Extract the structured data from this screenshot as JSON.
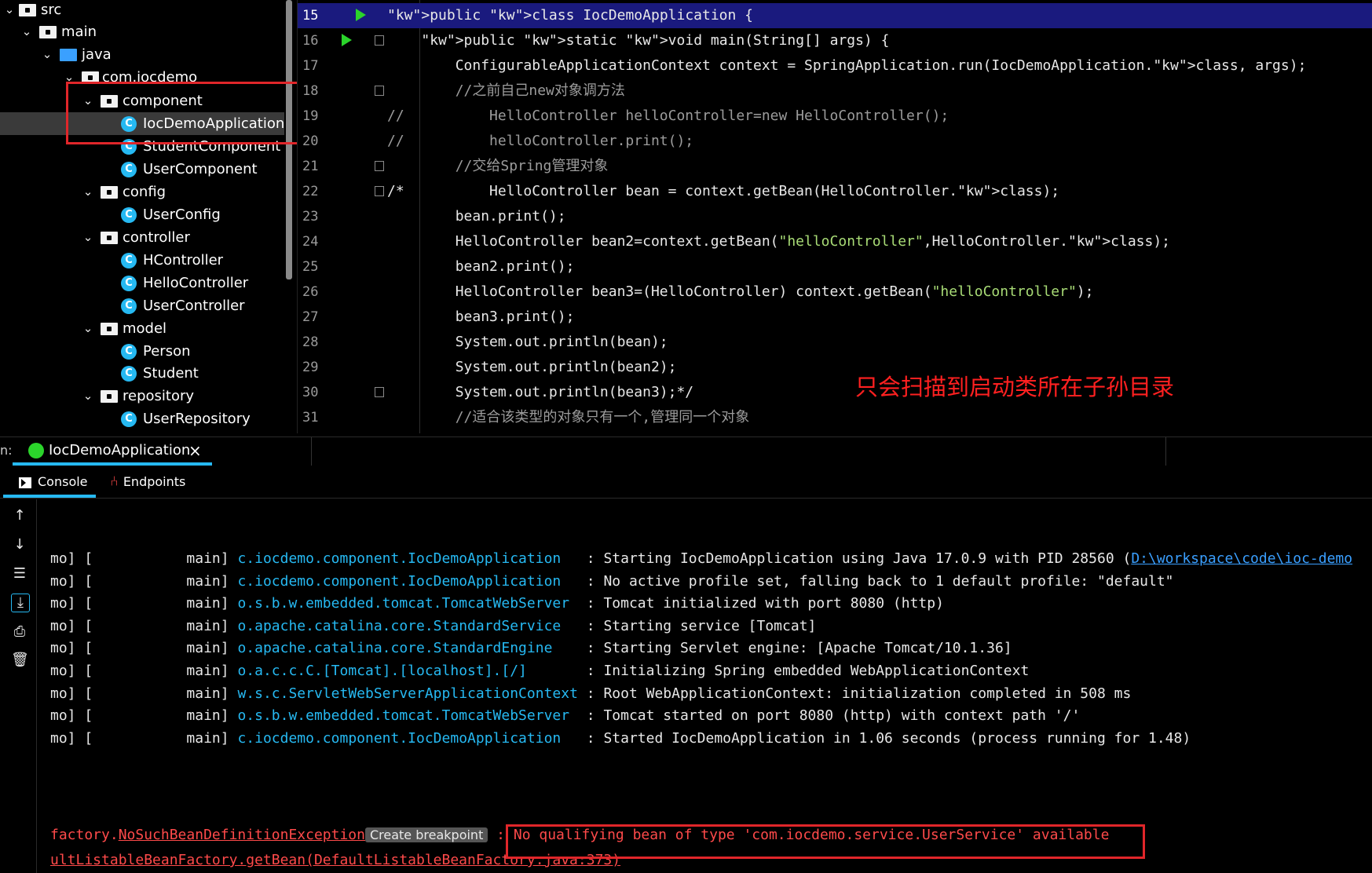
{
  "tree": {
    "items": [
      {
        "label": "src",
        "kind": "folder"
      },
      {
        "label": "main",
        "kind": "folder"
      },
      {
        "label": "java",
        "kind": "folder-blue"
      },
      {
        "label": "com.iocdemo",
        "kind": "package"
      },
      {
        "label": "component",
        "kind": "package"
      },
      {
        "label": "IocDemoApplication",
        "kind": "class-spring"
      },
      {
        "label": "StudentComponent",
        "kind": "class"
      },
      {
        "label": "UserComponent",
        "kind": "class"
      },
      {
        "label": "config",
        "kind": "package"
      },
      {
        "label": "UserConfig",
        "kind": "class"
      },
      {
        "label": "controller",
        "kind": "package"
      },
      {
        "label": "HController",
        "kind": "class"
      },
      {
        "label": "HelloController",
        "kind": "class"
      },
      {
        "label": "UserController",
        "kind": "class"
      },
      {
        "label": "model",
        "kind": "package"
      },
      {
        "label": "Person",
        "kind": "class"
      },
      {
        "label": "Student",
        "kind": "class"
      },
      {
        "label": "repository",
        "kind": "package"
      },
      {
        "label": "UserRepository",
        "kind": "class"
      }
    ]
  },
  "editor": {
    "lines": [
      {
        "num": "15",
        "text": "public class IocDemoApplication {"
      },
      {
        "num": "16",
        "text": "    public static void main(String[] args) {"
      },
      {
        "num": "17",
        "text": "        ConfigurableApplicationContext context = SpringApplication.run(IocDemoApplication.class, args);"
      },
      {
        "num": "18",
        "text": "        //之前自己new对象调方法"
      },
      {
        "num": "19",
        "text": "//          HelloController helloController=new HelloController();"
      },
      {
        "num": "20",
        "text": "//          helloController.print();"
      },
      {
        "num": "21",
        "text": "        //交给Spring管理对象"
      },
      {
        "num": "22",
        "text": "/*          HelloController bean = context.getBean(HelloController.class);"
      },
      {
        "num": "23",
        "text": "        bean.print();"
      },
      {
        "num": "24",
        "text": "        HelloController bean2=context.getBean(\"helloController\",HelloController.class);"
      },
      {
        "num": "25",
        "text": "        bean2.print();"
      },
      {
        "num": "26",
        "text": "        HelloController bean3=(HelloController) context.getBean(\"helloController\");"
      },
      {
        "num": "27",
        "text": "        bean3.print();"
      },
      {
        "num": "28",
        "text": "        System.out.println(bean);"
      },
      {
        "num": "29",
        "text": "        System.out.println(bean2);"
      },
      {
        "num": "30",
        "text": "        System.out.println(bean3);*/"
      },
      {
        "num": "31",
        "text": "        //适合该类型的对象只有一个,管理同一个对象"
      }
    ],
    "annotation": "只会扫描到启动类所在子孙目录"
  },
  "run_panel": {
    "prefix": "n:",
    "tab_label": "IocDemoApplication",
    "close_glyph": "×",
    "subtabs": {
      "console": "Console",
      "endpoints": "Endpoints"
    }
  },
  "console": {
    "lines": [
      {
        "prefix": "mo] [",
        "thread": "main]",
        "logger": "c.iocdemo.component.IocDemoApplication  ",
        "message": ": Starting IocDemoApplication using Java 17.0.9 with PID 28560 (",
        "link": "D:\\workspace\\code\\ioc-demo"
      },
      {
        "prefix": "mo] [",
        "thread": "main]",
        "logger": "c.iocdemo.component.IocDemoApplication  ",
        "message": ": No active profile set, falling back to 1 default profile: \"default\"",
        "link": ""
      },
      {
        "prefix": "mo] [",
        "thread": "main]",
        "logger": "o.s.b.w.embedded.tomcat.TomcatWebServer ",
        "message": ": Tomcat initialized with port 8080 (http)",
        "link": ""
      },
      {
        "prefix": "mo] [",
        "thread": "main]",
        "logger": "o.apache.catalina.core.StandardService  ",
        "message": ": Starting service [Tomcat]",
        "link": ""
      },
      {
        "prefix": "mo] [",
        "thread": "main]",
        "logger": "o.apache.catalina.core.StandardEngine   ",
        "message": ": Starting Servlet engine: [Apache Tomcat/10.1.36]",
        "link": ""
      },
      {
        "prefix": "mo] [",
        "thread": "main]",
        "logger": "o.a.c.c.C.[Tomcat].[localhost].[/]      ",
        "message": ": Initializing Spring embedded WebApplicationContext",
        "link": ""
      },
      {
        "prefix": "mo] [",
        "thread": "main]",
        "logger": "w.s.c.ServletWebServerApplicationContext",
        "message": ": Root WebApplicationContext: initialization completed in 508 ms",
        "link": ""
      },
      {
        "prefix": "mo] [",
        "thread": "main]",
        "logger": "o.s.b.w.embedded.tomcat.TomcatWebServer ",
        "message": ": Tomcat started on port 8080 (http) with context path '/'",
        "link": ""
      },
      {
        "prefix": "mo] [",
        "thread": "main]",
        "logger": "c.iocdemo.component.IocDemoApplication  ",
        "message": ": Started IocDemoApplication in 1.06 seconds (process running for 1.48)",
        "link": ""
      }
    ],
    "error": {
      "prefix": "factory.",
      "exception": "NoSuchBeanDefinitionException",
      "breakpoint": "Create breakpoint",
      "sep": " : ",
      "message": "No qualifying bean of type 'com.iocdemo.service.UserService' available"
    },
    "trace": "ultListableBeanFactory.getBean(DefaultListableBeanFactory.java:373)"
  },
  "colors": {
    "accent": "#26b9f2",
    "error": "#ff4a4a",
    "highlight": "#e0262a",
    "keyword": "#ff9f43"
  }
}
